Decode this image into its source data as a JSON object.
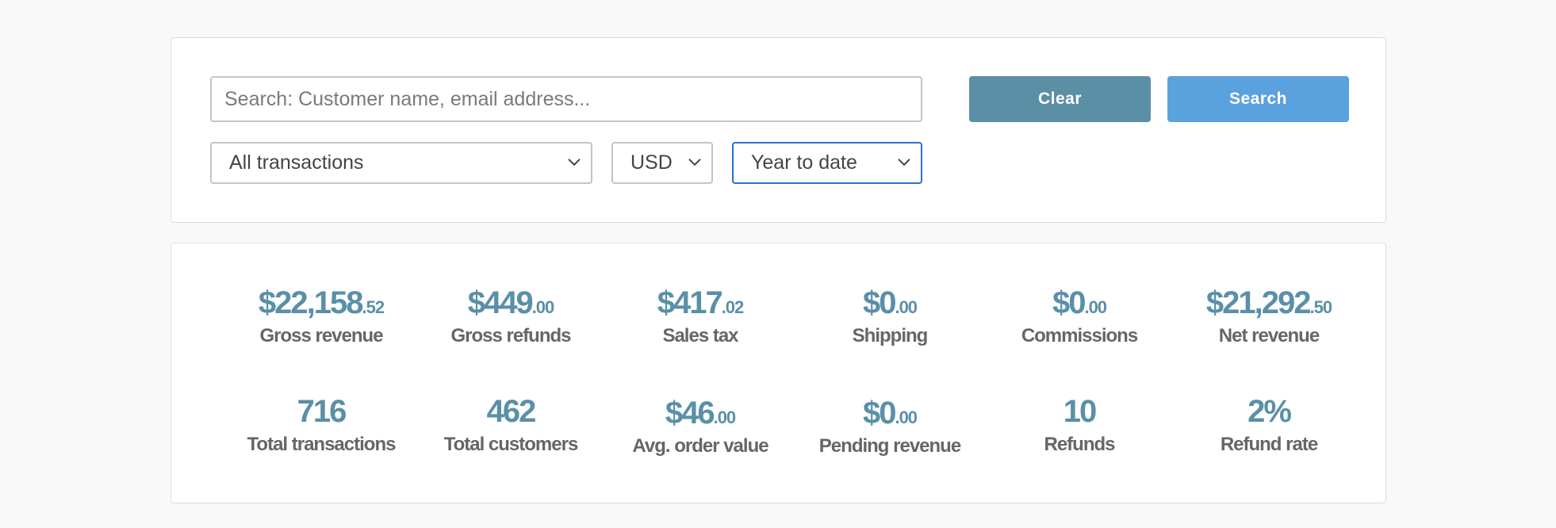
{
  "colors": {
    "page_bg": "#f9f9f9",
    "panel_bg": "#ffffff",
    "clear_button": "#5b8fa6",
    "search_button": "#5aa2dd",
    "stat_value": "#5a8fa8",
    "stat_label": "#666666",
    "focus_border": "#2b6fd6"
  },
  "filters": {
    "search_placeholder": "Search: Customer name, email address...",
    "search_value": "",
    "clear_label": "Clear",
    "search_label": "Search",
    "transaction_type": "All transactions",
    "currency": "USD",
    "date_range": "Year to date"
  },
  "stats": [
    {
      "dollars": "$22,158",
      "cents": ".52",
      "label": "Gross revenue"
    },
    {
      "dollars": "$449",
      "cents": ".00",
      "label": "Gross refunds"
    },
    {
      "dollars": "$417",
      "cents": ".02",
      "label": "Sales tax"
    },
    {
      "dollars": "$0",
      "cents": ".00",
      "label": "Shipping"
    },
    {
      "dollars": "$0",
      "cents": ".00",
      "label": "Commissions"
    },
    {
      "dollars": "$21,292",
      "cents": ".50",
      "label": "Net revenue"
    },
    {
      "dollars": "716",
      "cents": "",
      "label": "Total transactions"
    },
    {
      "dollars": "462",
      "cents": "",
      "label": "Total customers"
    },
    {
      "dollars": "$46",
      "cents": ".00",
      "label": "Avg. order value"
    },
    {
      "dollars": "$0",
      "cents": ".00",
      "label": "Pending revenue"
    },
    {
      "dollars": "10",
      "cents": "",
      "label": "Refunds"
    },
    {
      "dollars": "2%",
      "cents": "",
      "label": "Refund rate"
    }
  ]
}
